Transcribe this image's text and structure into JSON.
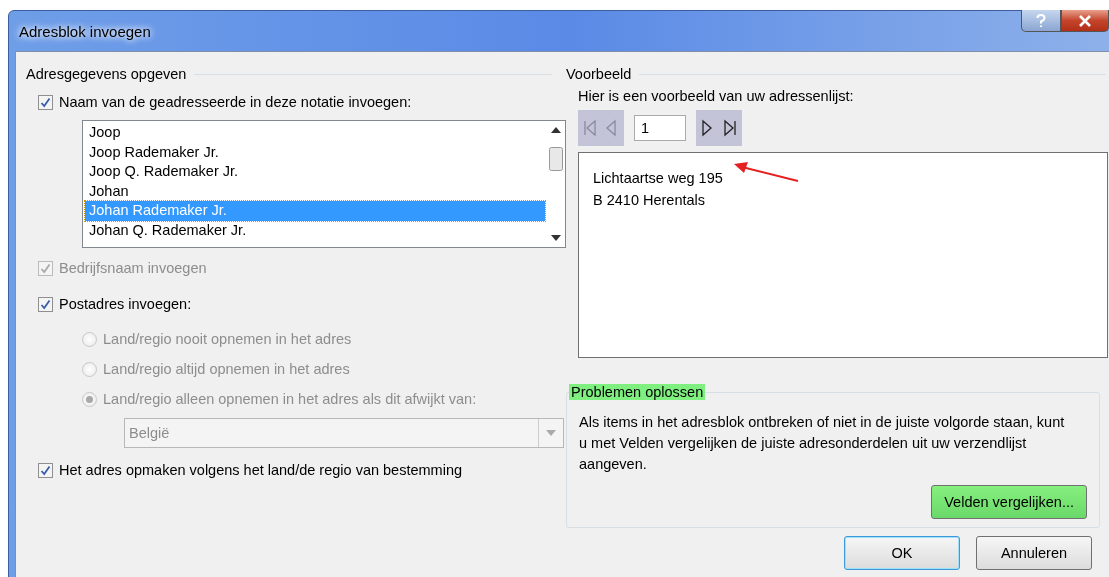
{
  "window": {
    "title": "Adresblok invoegen"
  },
  "left": {
    "heading": "Adresgegevens opgeven",
    "name_format": {
      "label": "Naam van de geadresseerde in deze notatie invoegen:",
      "checked": true,
      "options": [
        {
          "label": "Joop",
          "selected": false
        },
        {
          "label": "Joop Rademaker Jr.",
          "selected": false
        },
        {
          "label": "Joop Q. Rademaker Jr.",
          "selected": false
        },
        {
          "label": "Johan",
          "selected": false
        },
        {
          "label": "Johan Rademaker Jr.",
          "selected": true
        },
        {
          "label": "Johan Q. Rademaker Jr.",
          "selected": false
        }
      ]
    },
    "company": {
      "label": "Bedrijfsnaam invoegen",
      "checked": true,
      "disabled": true
    },
    "postal": {
      "label": "Postadres invoegen:",
      "checked": true,
      "radios": [
        {
          "label": "Land/regio nooit opnemen in het adres",
          "selected": false,
          "disabled": true
        },
        {
          "label": "Land/regio altijd opnemen in het adres",
          "selected": false,
          "disabled": true
        },
        {
          "label": "Land/regio alleen opnemen in het adres als dit afwijkt van:",
          "selected": true,
          "disabled": true
        }
      ],
      "country": {
        "value": "België",
        "disabled": true
      }
    },
    "format_by_country": {
      "label": "Het adres opmaken volgens het land/de regio van bestemming",
      "checked": true,
      "disabled": false
    }
  },
  "right": {
    "heading": "Voorbeeld",
    "preview_label": "Hier is een voorbeeld van uw adressenlijst:",
    "navigation": [
      {
        "kind": "first",
        "disabled": true
      },
      {
        "kind": "previous",
        "disabled": true
      },
      {
        "kind": "next",
        "disabled": false
      },
      {
        "kind": "last",
        "disabled": false
      }
    ],
    "record": "1",
    "preview_lines": [
      "Lichtaartse weg 195",
      "B 2410 Herentals"
    ],
    "troubleshoot": {
      "title": "Problemen oplossen",
      "highlighted": true,
      "text": "Als items in het adresblok ontbreken of niet in de juiste volgorde staan, kunt u met Velden vergelijken de juiste adresonderdelen uit uw verzendlijst aangeven.",
      "button": {
        "label": "Velden vergelijken...",
        "highlighted": true
      }
    }
  },
  "buttons": [
    {
      "label": "OK",
      "default": true
    },
    {
      "label": "Annuleren",
      "default": false
    }
  ]
}
